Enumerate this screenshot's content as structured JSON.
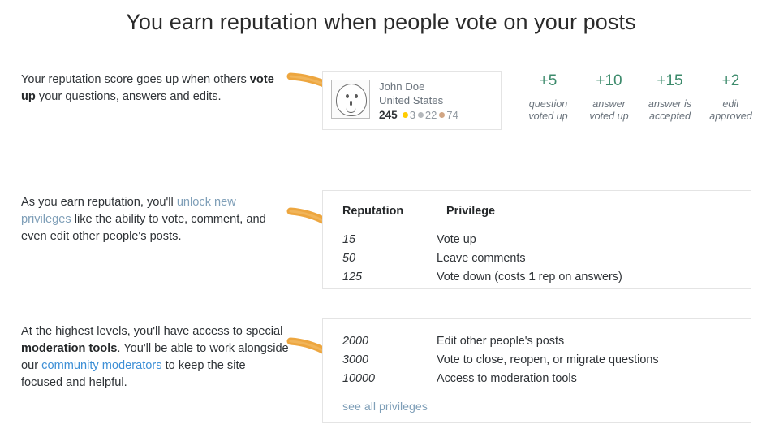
{
  "page": {
    "title": "You earn reputation when people vote on your posts",
    "accent_orange": "#eda63f",
    "link_muted": "#7f9fb8",
    "link_blue": "#3d8fd6",
    "award_green": "#3c8a6b",
    "border_gray": "#e4e4e4"
  },
  "sections": [
    {
      "blurb": {
        "part1": "Your reputation score goes up when others ",
        "strong1": "vote up",
        "part2": " your questions, answers and edits."
      }
    },
    {
      "blurb": {
        "part1": "As you earn reputation, you'll ",
        "link1": "unlock new privileges",
        "part2": " like the ability to vote, comment, and even edit other people's posts."
      }
    },
    {
      "blurb": {
        "part1": "At the highest levels, you'll have access to special ",
        "strong1": "moderation tools",
        "part2": ". You'll be able to work alongside our ",
        "link1": "community moderators",
        "part3": " to keep the site focused and helpful."
      }
    }
  ],
  "user_card": {
    "avatar_icon": "user-face-avatar-icon",
    "name": "John Doe",
    "location": "United States",
    "reputation": "245",
    "badges": [
      {
        "tier": "gold",
        "count": "3",
        "color": "#ffcc01"
      },
      {
        "tier": "silver",
        "count": "22",
        "color": "#b4b8bc"
      },
      {
        "tier": "bronze",
        "count": "74",
        "color": "#d1a684"
      }
    ]
  },
  "rep_awards": [
    {
      "value": "+5",
      "label_line1": "question",
      "label_line2": "voted up"
    },
    {
      "value": "+10",
      "label_line1": "answer",
      "label_line2": "voted up"
    },
    {
      "value": "+15",
      "label_line1": "answer is",
      "label_line2": "accepted"
    },
    {
      "value": "+2",
      "label_line1": "edit",
      "label_line2": "approved"
    }
  ],
  "privileges_basic": {
    "header": {
      "reputation": "Reputation",
      "privilege": "Privilege"
    },
    "rows": [
      {
        "rep": "15",
        "priv_pre": "Vote up",
        "priv_strong": "",
        "priv_post": ""
      },
      {
        "rep": "50",
        "priv_pre": "Leave comments",
        "priv_strong": "",
        "priv_post": ""
      },
      {
        "rep": "125",
        "priv_pre": "Vote down (costs ",
        "priv_strong": "1",
        "priv_post": " rep on answers)"
      }
    ]
  },
  "privileges_advanced": {
    "rows": [
      {
        "rep": "2000",
        "priv_pre": "Edit other people's posts",
        "priv_strong": "",
        "priv_post": ""
      },
      {
        "rep": "3000",
        "priv_pre": "Vote to close, reopen, or migrate questions",
        "priv_strong": "",
        "priv_post": ""
      },
      {
        "rep": "10000",
        "priv_pre": "Access to moderation tools",
        "priv_strong": "",
        "priv_post": ""
      }
    ],
    "see_all_link": "see all privileges"
  }
}
